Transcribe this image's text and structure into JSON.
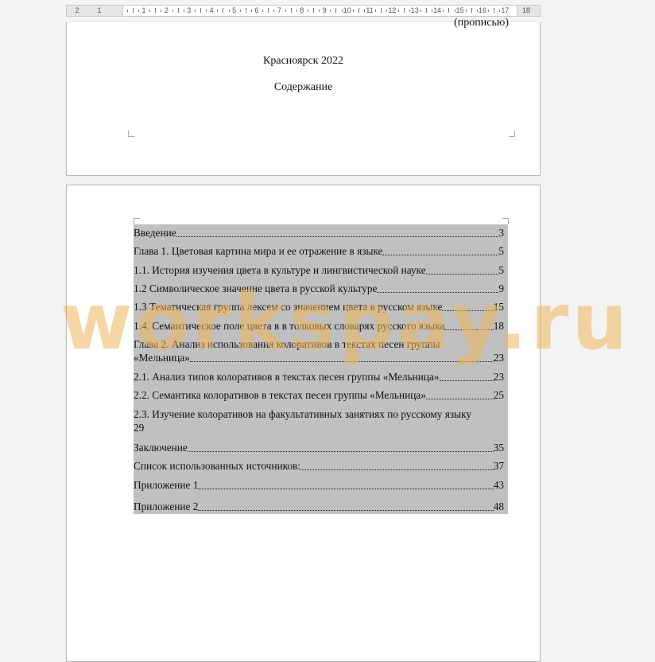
{
  "ruler": {
    "left_numbers": [
      "2",
      "1"
    ],
    "numbers": [
      "1",
      "2",
      "3",
      "4",
      "5",
      "6",
      "7",
      "8",
      "9",
      "10",
      "11",
      "12",
      "13",
      "14",
      "15",
      "16",
      "17",
      "18"
    ]
  },
  "page1": {
    "cut_text": "(прописью)",
    "city_year": "Красноярск 2022",
    "heading": "Содержание"
  },
  "toc": {
    "items": [
      {
        "text": "Введение",
        "page": "3"
      },
      {
        "text": "Глава 1. Цветовая картина мира и ее отражение в языке",
        "page": "5"
      },
      {
        "text": "1.1.  История изучения цвета в культуре и лингвистической науке",
        "page": "5"
      },
      {
        "text": "1.2  Символическое значение цвета в русской культуре",
        "page": "9"
      },
      {
        "text": "1.3  Тематическая группа лексем со значением цвета в русском языке",
        "page": "15"
      },
      {
        "text": "1.4. Семантическое поле цвета в в толковых словарях русского языка",
        "page": "18"
      },
      {
        "text": "Глава 2. Анализ использования колоративов в текстах песен группы",
        "text2": "«Мельница»",
        "page": "23"
      },
      {
        "text": "2.1.   Анализ типов колоративов в текстах песен группы «Мельница»",
        "page": "23"
      },
      {
        "text": "2.2.   Семантика колоративов в текстах песен группы «Мельница»",
        "page": "25"
      },
      {
        "text": "2.3.   Изучение колоративов на факультативных занятиях по русскому языку",
        "text2": "29"
      },
      {
        "text": "Заключение",
        "page": "35"
      },
      {
        "text": "Список использованных источников:",
        "page": "37"
      },
      {
        "text": "Приложение 1",
        "page": "43"
      },
      {
        "text": "Приложение 2",
        "page": "48"
      }
    ]
  },
  "watermark": "workspay.ru",
  "colors": {
    "selection": "#c0c0c0",
    "watermark": "#ecb45a",
    "background": "#f3f3f3"
  }
}
